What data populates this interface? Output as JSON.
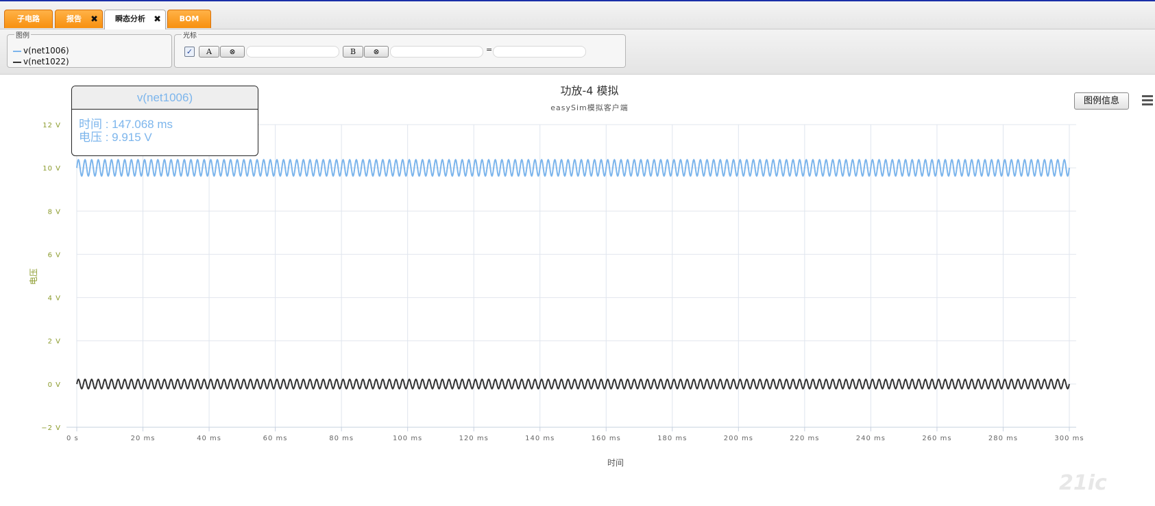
{
  "tabs": [
    {
      "label": "子电路",
      "active": false,
      "closable": false
    },
    {
      "label": "报告",
      "active": false,
      "closable": true
    },
    {
      "label": "瞬态分析",
      "active": true,
      "closable": true
    },
    {
      "label": "BOM",
      "active": false,
      "closable": false
    }
  ],
  "close_glyph": "✖",
  "legend_panel": {
    "title": "图例",
    "items": [
      {
        "label": "v(net1006)",
        "color": "#7cb5ec"
      },
      {
        "label": "v(net1022)",
        "color": "#333333"
      }
    ]
  },
  "cursor_panel": {
    "title": "光标",
    "checkbox_checked": true,
    "button_a": "A",
    "button_b": "B",
    "clear_glyph": "⊗",
    "equals": "="
  },
  "tooltip": {
    "series": "v(net1006)",
    "time_line": "时间 : 147.068 ms",
    "voltage_line": "电压 : 9.915 V"
  },
  "legend_info_button": "图例信息",
  "watermark_text": "21ic",
  "chart_data": {
    "type": "line",
    "title": "功放-4 模拟",
    "subtitle": "easySim模拟客户端",
    "xlabel": "时间",
    "ylabel": "电压",
    "xlim": [
      0,
      300
    ],
    "ylim": [
      -2,
      12
    ],
    "x_ticks": [
      "0 s",
      "20 ms",
      "40 ms",
      "60 ms",
      "80 ms",
      "100 ms",
      "120 ms",
      "140 ms",
      "160 ms",
      "180 ms",
      "200 ms",
      "220 ms",
      "240 ms",
      "260 ms",
      "280 ms",
      "300 ms"
    ],
    "x_tick_values": [
      0,
      20,
      40,
      60,
      80,
      100,
      120,
      140,
      160,
      180,
      200,
      220,
      240,
      260,
      280,
      300
    ],
    "y_ticks": [
      "−2 V",
      "0 V",
      "2 V",
      "4 V",
      "6 V",
      "8 V",
      "10 V",
      "12 V"
    ],
    "y_tick_values": [
      -2,
      0,
      2,
      4,
      6,
      8,
      10,
      12
    ],
    "grid": true,
    "series": [
      {
        "name": "v(net1006)",
        "color": "#7cb5ec",
        "shape": "sine",
        "offset": 10.0,
        "amplitude": 0.38,
        "cycles": 150,
        "x_end": 300
      },
      {
        "name": "v(net1022)",
        "color": "#333333",
        "shape": "sine",
        "offset": 0.0,
        "amplitude": 0.22,
        "cycles": 150,
        "x_end": 300
      }
    ]
  }
}
